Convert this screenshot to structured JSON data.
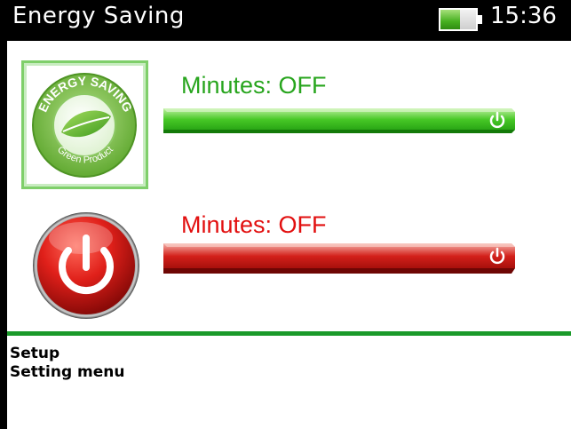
{
  "header": {
    "title": "Energy Saving",
    "time": "15:36",
    "battery_level_percent": 55
  },
  "energy_saving": {
    "label": "Minutes:  OFF",
    "color": "#28a51e",
    "logo_text_top": "ENERGY SAVING",
    "logo_text_bottom": "Green Product",
    "slider_icon": "power-icon"
  },
  "power_off": {
    "label": "Minutes:  OFF",
    "color": "#e20f0f",
    "slider_icon": "power-icon"
  },
  "footer": {
    "line1": "Setup",
    "line2": "Setting  menu"
  },
  "colors": {
    "divider": "#1a9a2a",
    "title_bar": "#000000"
  }
}
